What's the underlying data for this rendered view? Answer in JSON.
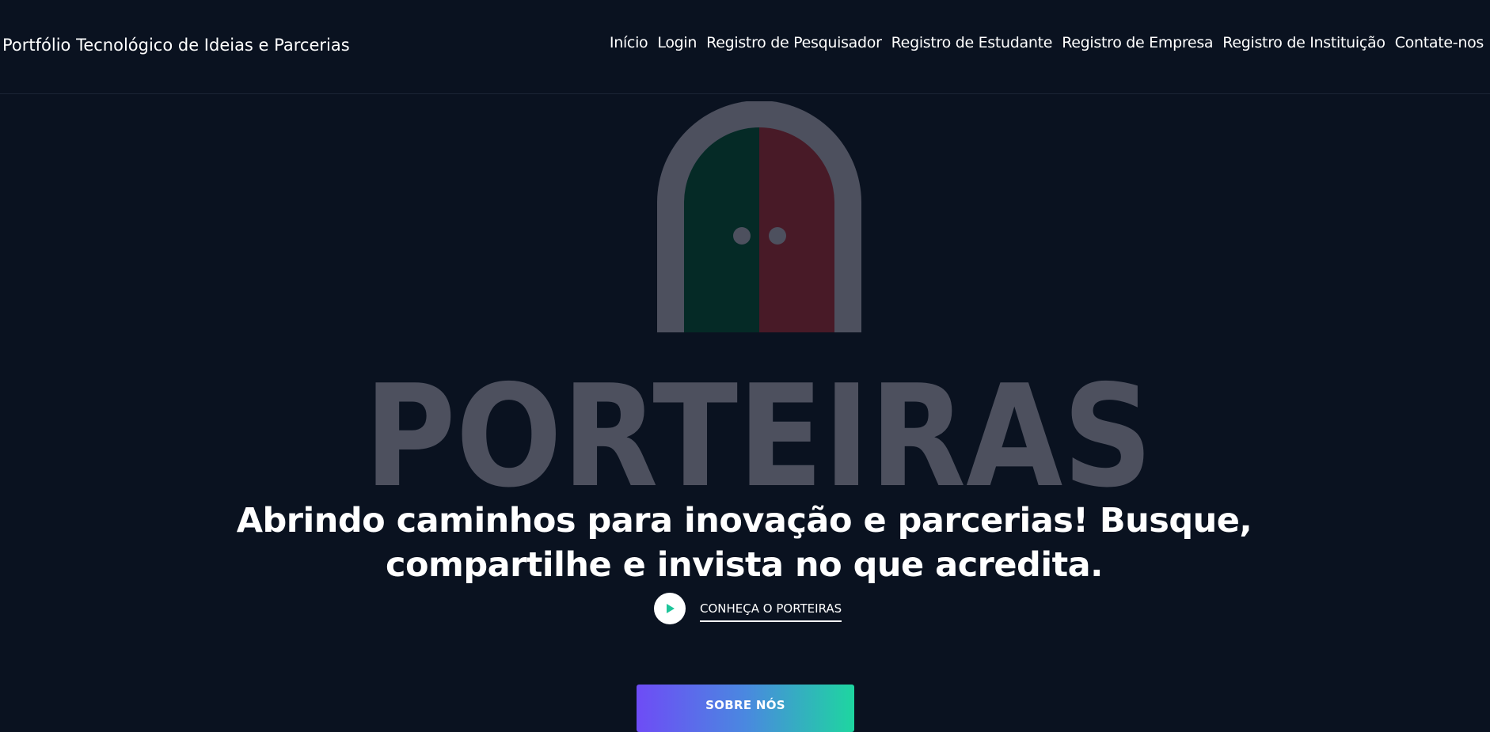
{
  "navbar": {
    "brand": "Portfólio Tecnológico de Ideias e Parcerias",
    "links": [
      {
        "label": "Início"
      },
      {
        "label": "Login"
      },
      {
        "label": "Registro de Pesquisador"
      },
      {
        "label": "Registro de Estudante"
      },
      {
        "label": "Registro de Empresa"
      },
      {
        "label": "Registro de Instituição"
      },
      {
        "label": "Contate-nos"
      }
    ]
  },
  "hero": {
    "logo_wordmark": "PORTEIRAS",
    "tagline_line1": "Abrindo caminhos para inovação e parcerias! Busque,",
    "tagline_line2": "compartilhe e invista no que acredita.",
    "video_link_label": "CONHEÇA O PORTEIRAS",
    "cta_label": "SOBRE NÓS"
  },
  "colors": {
    "background": "#0a1220",
    "logo_gray": "#4d505e",
    "door_green": "#052a26",
    "door_red": "#481a27",
    "play_icon": "#1dc59a",
    "cta_gradient_start": "#6e4cf6",
    "cta_gradient_end": "#1ed6a0"
  },
  "icons": {
    "logo": "gate-arch-logo",
    "play": "play-icon"
  }
}
